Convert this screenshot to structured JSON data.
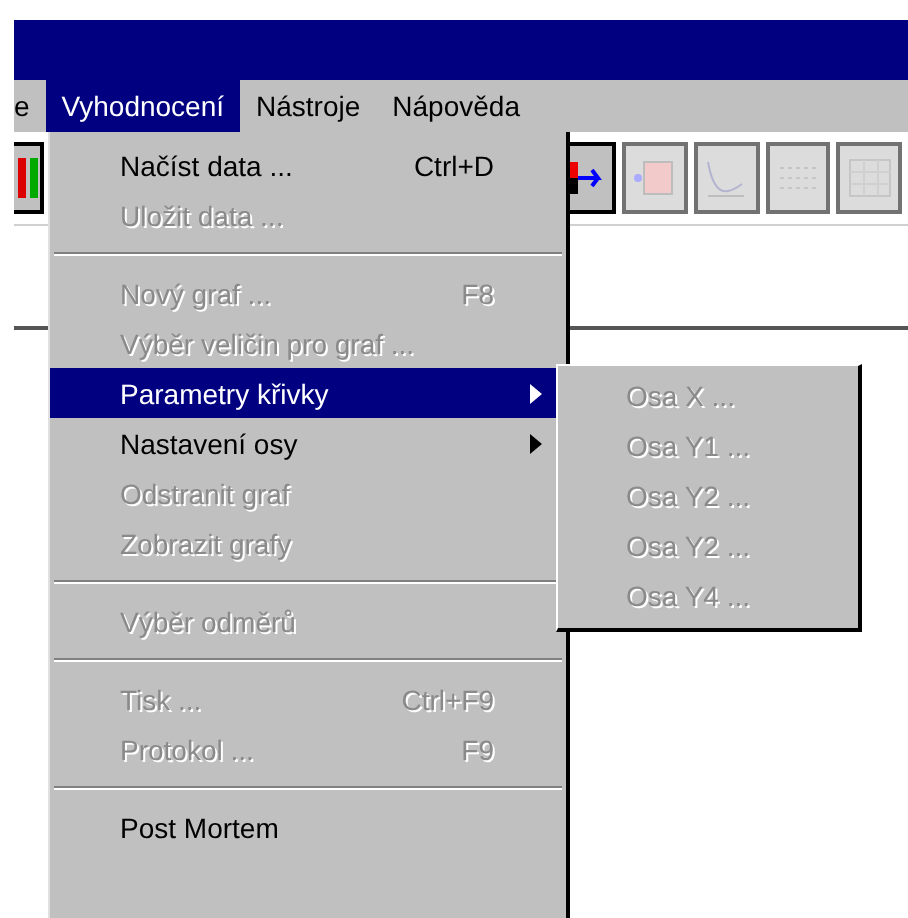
{
  "menu_bar": [
    {
      "label": "e",
      "selected": false
    },
    {
      "label": "Vyhodnocení",
      "selected": true
    },
    {
      "label": "Nástroje",
      "selected": false
    },
    {
      "label": "Nápověda",
      "selected": false
    }
  ],
  "toolbar": [
    {
      "kind": "chart",
      "disabled": false
    },
    {
      "kind": "arrow",
      "disabled": false
    },
    {
      "kind": "grid",
      "disabled": true
    },
    {
      "kind": "curve",
      "disabled": true
    },
    {
      "kind": "dots",
      "disabled": true
    },
    {
      "kind": "table",
      "disabled": true
    }
  ],
  "menu": [
    {
      "kind": "item",
      "label": "Načíst data ...",
      "shortcut": "Ctrl+D",
      "disabled": false,
      "selected": false
    },
    {
      "kind": "item",
      "label": "Uložit data ...",
      "disabled": true,
      "selected": false
    },
    {
      "kind": "separator"
    },
    {
      "kind": "item",
      "label": "Nový graf ...",
      "shortcut": "F8",
      "disabled": true,
      "selected": false
    },
    {
      "kind": "item",
      "label": "Výběr veličin pro graf ...",
      "disabled": true,
      "selected": false
    },
    {
      "kind": "submenu",
      "label": "Parametry křivky",
      "disabled": false,
      "selected": true
    },
    {
      "kind": "submenu",
      "label": "Nastavení osy",
      "disabled": false,
      "selected": false
    },
    {
      "kind": "item",
      "label": "Odstranit graf",
      "disabled": true,
      "selected": false
    },
    {
      "kind": "item",
      "label": "Zobrazit grafy",
      "disabled": true,
      "selected": false
    },
    {
      "kind": "separator"
    },
    {
      "kind": "item",
      "label": "Výběr odměrů",
      "disabled": true,
      "selected": false
    },
    {
      "kind": "separator"
    },
    {
      "kind": "item",
      "label": "Tisk ...",
      "shortcut": "Ctrl+F9",
      "disabled": true,
      "selected": false
    },
    {
      "kind": "item",
      "label": "Protokol ...",
      "shortcut": "F9",
      "disabled": true,
      "selected": false
    },
    {
      "kind": "separator"
    },
    {
      "kind": "item",
      "label": "Post Mortem",
      "disabled": false,
      "selected": false
    }
  ],
  "submenu": [
    {
      "label": "Osa X ...",
      "disabled": true
    },
    {
      "label": "Osa Y1 ...",
      "disabled": true
    },
    {
      "label": "Osa Y2 ...",
      "disabled": true
    },
    {
      "label": "Osa Y2 ...",
      "disabled": true
    },
    {
      "label": "Osa Y4 ...",
      "disabled": true
    }
  ]
}
